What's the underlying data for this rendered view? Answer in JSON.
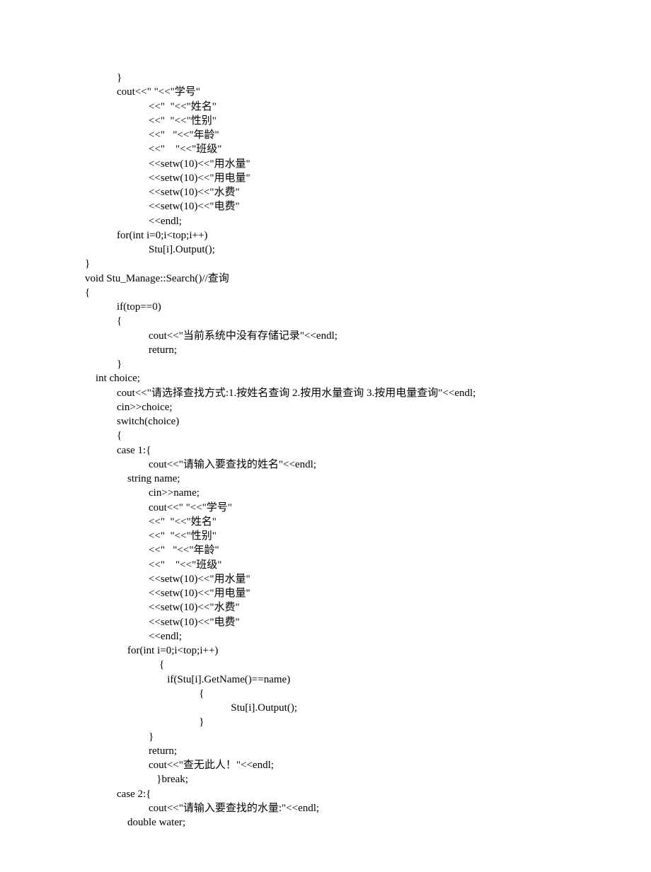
{
  "lines": [
    "            }",
    "            cout<<\" \"<<\"学号\"",
    "                        <<\"  \"<<\"姓名\"",
    "                        <<\"  \"<<\"性别\"",
    "                        <<\"   \"<<\"年龄\"",
    "                        <<\"    \"<<\"班级\"",
    "                        <<setw(10)<<\"用水量\"",
    "                        <<setw(10)<<\"用电量\"",
    "                        <<setw(10)<<\"水费\"",
    "                        <<setw(10)<<\"电费\"",
    "                        <<endl;",
    "            for(int i=0;i<top;i++)",
    "                        Stu[i].Output();",
    "}",
    "void Stu_Manage::Search()//查询",
    "{",
    "            if(top==0)",
    "            {",
    "                        cout<<\"当前系统中没有存储记录\"<<endl;",
    "                        return;",
    "            }",
    "    int choice;",
    "            cout<<\"请选择查找方式:1.按姓名查询 2.按用水量查询 3.按用电量查询\"<<endl;",
    "            cin>>choice;",
    "            switch(choice)",
    "            {",
    "            case 1:{",
    "                        cout<<\"请输入要查找的姓名\"<<endl;",
    "                string name;",
    "                        cin>>name;",
    "                        cout<<\" \"<<\"学号\"",
    "                        <<\"  \"<<\"姓名\"",
    "                        <<\"  \"<<\"性别\"",
    "                        <<\"   \"<<\"年龄\"",
    "                        <<\"    \"<<\"班级\"",
    "                        <<setw(10)<<\"用水量\"",
    "                        <<setw(10)<<\"用电量\"",
    "                        <<setw(10)<<\"水费\"",
    "                        <<setw(10)<<\"电费\"",
    "                        <<endl;",
    "                for(int i=0;i<top;i++)",
    "                            {",
    "                               if(Stu[i].GetName()==name)",
    "                                           {",
    "                                                       Stu[i].Output();",
    "                                           }",
    "                        }",
    "                        return;",
    "                        cout<<\"查无此人！\"<<endl;",
    "                           }break;",
    "            case 2:{",
    "                        cout<<\"请输入要查找的水量:\"<<endl;",
    "                double water;"
  ]
}
